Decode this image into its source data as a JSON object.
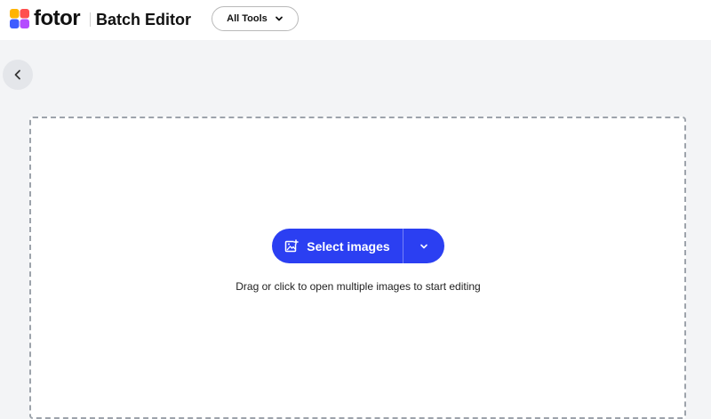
{
  "header": {
    "brand": "fotor",
    "title": "Batch Editor",
    "tools_menu_label": "All Tools",
    "tools_menu_icon": "chevron-down-icon"
  },
  "navigation": {
    "back_icon": "chevron-left-icon"
  },
  "upload": {
    "select_label": "Select images",
    "select_icon": "image-add-icon",
    "dropdown_icon": "chevron-down-icon",
    "hint": "Drag or click to open multiple images to start editing",
    "accent_color": "#2b3ff2"
  }
}
